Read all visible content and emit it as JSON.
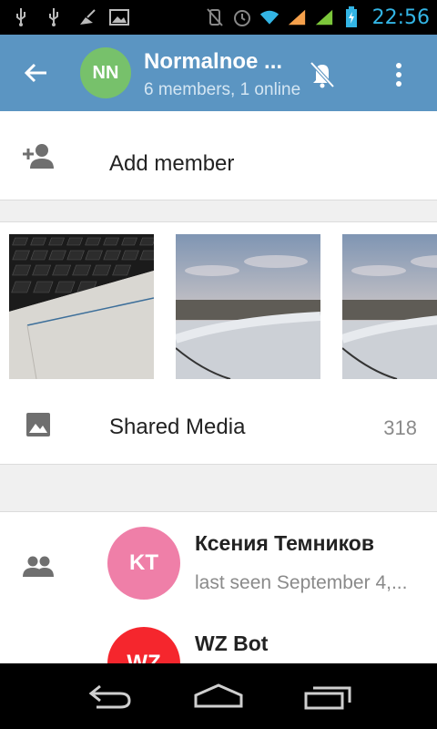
{
  "status_bar": {
    "time": "22:56",
    "icons": [
      "usb-icon",
      "usb-icon",
      "cleaner-icon",
      "image-icon",
      "vibrate-off-icon",
      "alarm-icon",
      "wifi-icon",
      "signal-icon",
      "signal-2-icon",
      "battery-charging-icon"
    ]
  },
  "app_bar": {
    "avatar_initials": "NN",
    "avatar_color": "#77c16b",
    "title": "Normalnoe ...",
    "subtitle": "6 members, 1 online",
    "bar_color": "#5b95c2"
  },
  "add_member": {
    "label": "Add member",
    "icon": "add-person-icon"
  },
  "shared_media": {
    "label": "Shared Media",
    "count": "318",
    "icon": "image-icon",
    "thumbnails": [
      "keyboard-photo",
      "airplane-wing-photo",
      "airplane-wing-photo"
    ]
  },
  "members": {
    "icon": "group-icon",
    "items": [
      {
        "initials": "KT",
        "name": "Ксения Темников",
        "status": "last seen September 4,...",
        "color": "#ef7fa8"
      },
      {
        "initials": "WZ",
        "name": "WZ Bot",
        "status": "",
        "color": "#f5262d"
      }
    ]
  },
  "nav_bar": {
    "buttons": [
      "back-icon",
      "home-icon",
      "recents-icon"
    ]
  }
}
